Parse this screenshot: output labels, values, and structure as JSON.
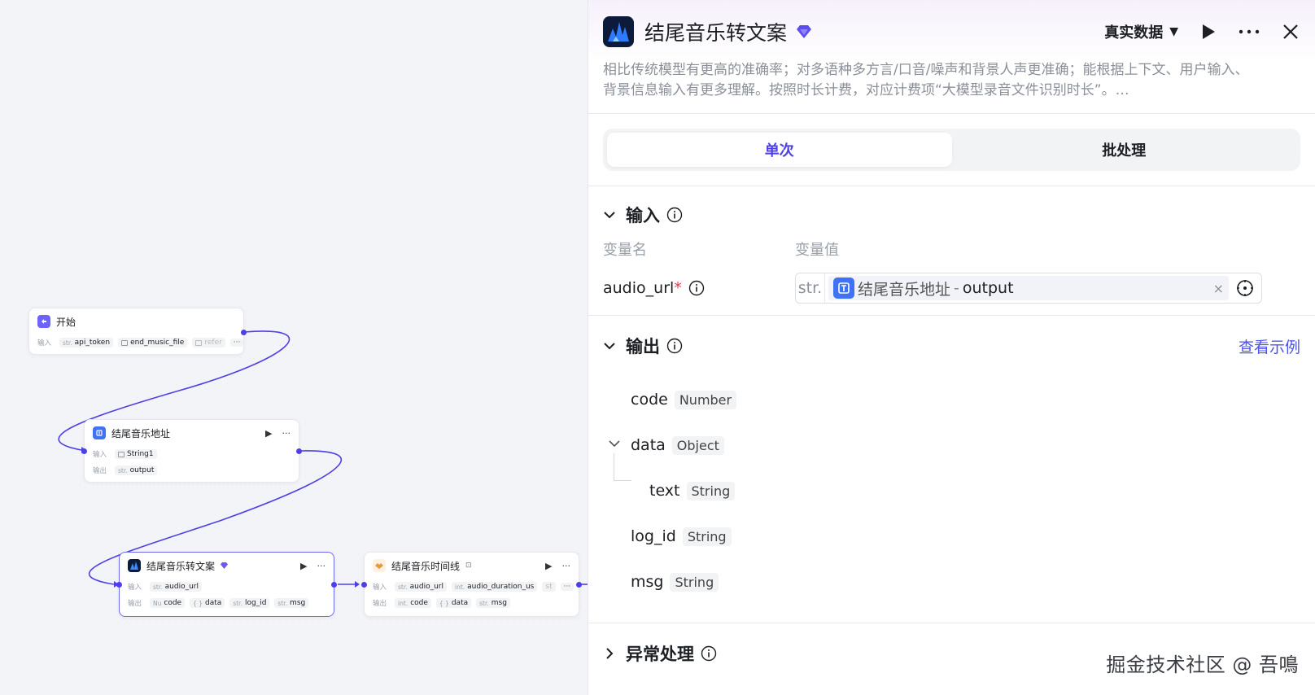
{
  "canvas": {
    "nodes": {
      "start": {
        "title": "开始",
        "input_label": "输入",
        "inputs": [
          {
            "type": "str.",
            "name": "api_token"
          },
          {
            "type": "",
            "name": "end_music_file"
          },
          {
            "type": "",
            "name": "refer"
          }
        ],
        "more": "···"
      },
      "music_url": {
        "title": "结尾音乐地址",
        "input_label": "输入",
        "output_label": "输出",
        "inputs": [
          {
            "type": "",
            "name": "String1"
          }
        ],
        "outputs": [
          {
            "type": "str.",
            "name": "output"
          }
        ],
        "more": "···"
      },
      "music_to_text": {
        "title": "结尾音乐转文案",
        "input_label": "输入",
        "output_label": "输出",
        "inputs": [
          {
            "type": "str.",
            "name": "audio_url"
          }
        ],
        "outputs": [
          {
            "type": "Nu",
            "name": "code"
          },
          {
            "type": "{ }",
            "name": "data"
          },
          {
            "type": "str.",
            "name": "log_id"
          },
          {
            "type": "str.",
            "name": "msg"
          }
        ],
        "more": "···"
      },
      "timeline": {
        "title": "结尾音乐时间线",
        "input_label": "输入",
        "output_label": "输出",
        "inputs": [
          {
            "type": "str.",
            "name": "audio_url"
          },
          {
            "type": "int.",
            "name": "audio_duration_us"
          },
          {
            "type": "",
            "name": "st"
          }
        ],
        "outputs": [
          {
            "type": "int.",
            "name": "code"
          },
          {
            "type": "{ }",
            "name": "data"
          },
          {
            "type": "str.",
            "name": "msg"
          }
        ],
        "more": "···"
      }
    }
  },
  "panel": {
    "title": "结尾音乐转文案",
    "data_mode": "真实数据",
    "description": "相比传统模型有更高的准确率；对多语种多方言/口音/噪声和背景人声更准确；能根据上下文、用户输入、背景信息输入有更多理解。按照时长计费，对应计费项“大模型录音文件识别时长”。…",
    "tabs": [
      "单次",
      "批处理"
    ],
    "input_section": {
      "title": "输入",
      "col_name": "变量名",
      "col_value": "变量值",
      "var_name": "audio_url",
      "required_mark": "*",
      "type_prefix": "str.",
      "ref_source": "结尾音乐地址",
      "ref_sep": "-",
      "ref_field": "output",
      "clear": "×"
    },
    "output_section": {
      "title": "输出",
      "view_example": "查看示例",
      "items": [
        {
          "name": "code",
          "type": "Number"
        },
        {
          "name": "data",
          "type": "Object"
        },
        {
          "name": "text",
          "type": "String"
        },
        {
          "name": "log_id",
          "type": "String"
        },
        {
          "name": "msg",
          "type": "String"
        }
      ]
    },
    "error_section": {
      "title": "异常处理"
    },
    "watermark": "掘金技术社区 @ 吾鳴"
  },
  "colors": {
    "accent": "#4e40e5",
    "link": "#4d53e8",
    "edge": "#4e40e5"
  }
}
